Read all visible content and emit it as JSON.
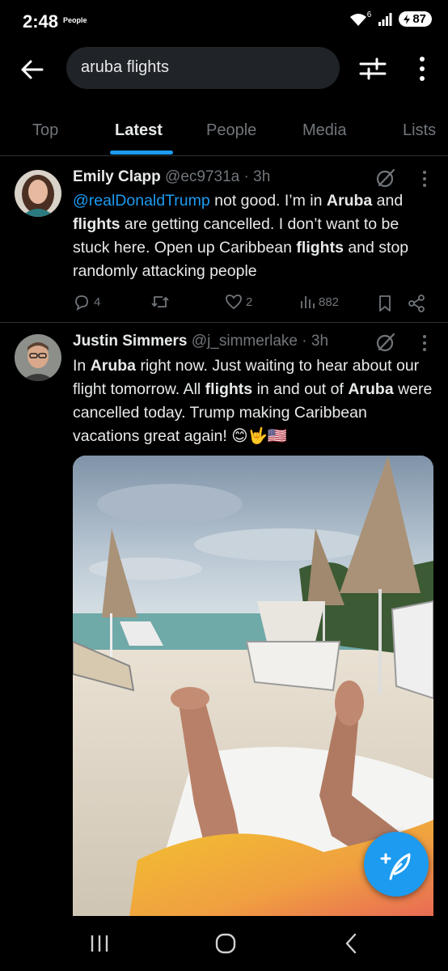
{
  "status_bar": {
    "time": "2:48",
    "app_label": "People",
    "network": "6",
    "battery": "87"
  },
  "search": {
    "query": "aruba flights"
  },
  "tabs": [
    {
      "label": "Top"
    },
    {
      "label": "Latest"
    },
    {
      "label": "People"
    },
    {
      "label": "Media"
    },
    {
      "label": "Lists"
    }
  ],
  "active_tab": "Latest",
  "tweets": [
    {
      "name": "Emily Clapp",
      "handle": "@ec9731a",
      "time": "· 3h",
      "mention": "@realDonaldTrump",
      "text_parts": [
        " not good. I’m in ",
        "Aruba",
        " and ",
        "flights",
        " are getting cancelled. I don’t want to be stuck here. Open up Caribbean ",
        "flights",
        " and stop randomly attacking people"
      ],
      "replies": "4",
      "retweets": "",
      "likes": "2",
      "views": "882"
    },
    {
      "name": "Justin Simmers",
      "handle": "@j_simmerlake",
      "time": "· 3h",
      "text_parts": [
        "In ",
        "Aruba",
        " right now. Just waiting to hear about our flight tomorrow. All ",
        "flights",
        " in and out of ",
        "Aruba",
        " were cancelled today. Trump making Caribbean vacations great again! ",
        "😊🤟🇺🇸"
      ]
    }
  ],
  "colors": {
    "accent": "#1d9bf0",
    "muted": "#71767b",
    "text": "#e7e9ea",
    "background": "#000000"
  }
}
